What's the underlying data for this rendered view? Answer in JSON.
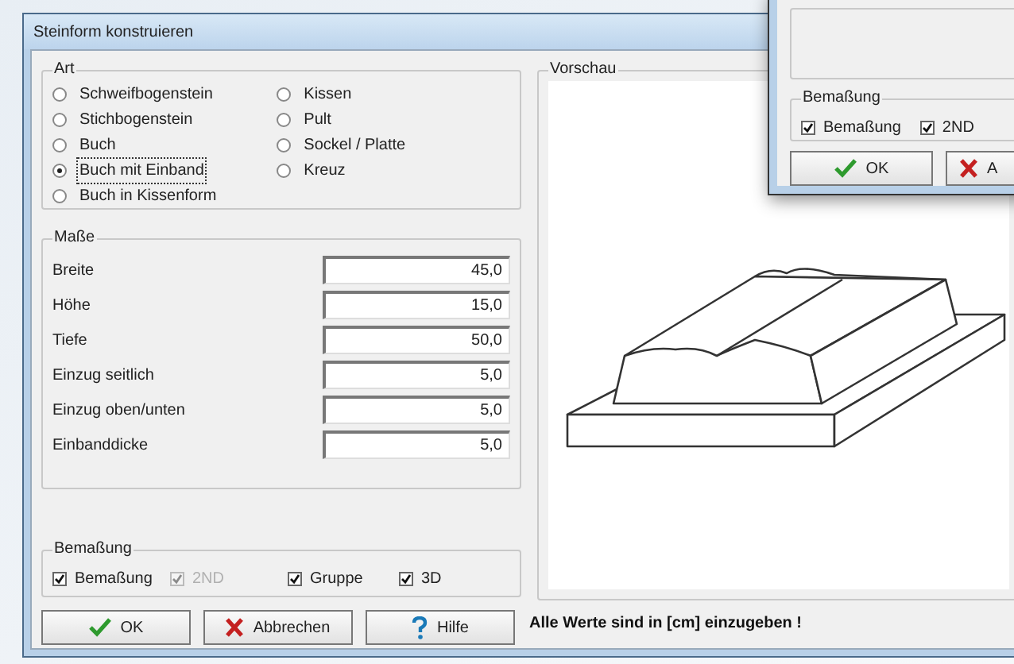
{
  "main_window": {
    "title": "Steinform konstruieren",
    "art": {
      "label": "Art",
      "options": [
        {
          "label": "Schweifbogenstein",
          "selected": false
        },
        {
          "label": "Stichbogenstein",
          "selected": false
        },
        {
          "label": "Buch",
          "selected": false
        },
        {
          "label": "Buch mit Einband",
          "selected": true
        },
        {
          "label": "Buch in Kissenform",
          "selected": false
        },
        {
          "label": "Kissen",
          "selected": false
        },
        {
          "label": "Pult",
          "selected": false
        },
        {
          "label": "Sockel / Platte",
          "selected": false
        },
        {
          "label": "Kreuz",
          "selected": false
        }
      ]
    },
    "masse": {
      "label": "Maße",
      "fields": [
        {
          "label": "Breite",
          "value": "45,0"
        },
        {
          "label": "Höhe",
          "value": "15,0"
        },
        {
          "label": "Tiefe",
          "value": "50,0"
        },
        {
          "label": "Einzug seitlich",
          "value": "5,0"
        },
        {
          "label": "Einzug oben/unten",
          "value": "5,0"
        },
        {
          "label": "Einbanddicke",
          "value": "5,0"
        }
      ]
    },
    "bemassung": {
      "label": "Bemaßung",
      "checks": [
        {
          "label": "Bemaßung",
          "checked": true,
          "disabled": false
        },
        {
          "label": "2ND",
          "checked": true,
          "disabled": true
        },
        {
          "label": "Gruppe",
          "checked": true,
          "disabled": false
        },
        {
          "label": "3D",
          "checked": true,
          "disabled": false
        }
      ]
    },
    "buttons": [
      {
        "kind": "ok",
        "label": "OK"
      },
      {
        "kind": "cancel",
        "label": "Abbrechen"
      },
      {
        "kind": "help",
        "label": "Hilfe"
      }
    ],
    "hint": "Alle Werte sind in [cm] einzugeben !",
    "preview": {
      "label": "Vorschau"
    }
  },
  "second_window": {
    "bemassung": {
      "label": "Bemaßung",
      "checks": [
        {
          "label": "Bemaßung",
          "checked": true,
          "disabled": false
        },
        {
          "label": "2ND",
          "checked": true,
          "disabled": false
        }
      ]
    },
    "buttons": [
      {
        "kind": "ok",
        "label": "OK"
      },
      {
        "kind": "cancel",
        "label": "A"
      }
    ]
  }
}
